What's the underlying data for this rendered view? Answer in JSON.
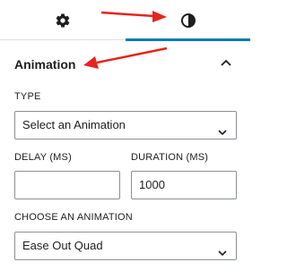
{
  "tabs": [
    {
      "name": "settings",
      "icon": "gear-icon"
    },
    {
      "name": "styles",
      "icon": "half-circle-icon",
      "active": true
    }
  ],
  "panel": {
    "title": "Animation",
    "expanded": true
  },
  "fields": {
    "type_label": "TYPE",
    "type_value": "Select an Animation",
    "delay_label": "DELAY (MS)",
    "delay_value": "",
    "duration_label": "DURATION (MS)",
    "duration_value": "1000",
    "choose_label": "CHOOSE AN ANIMATION",
    "choose_value": "Ease Out Quad"
  },
  "colors": {
    "accent": "#007cba",
    "annotation_arrow": "#e8231f"
  }
}
